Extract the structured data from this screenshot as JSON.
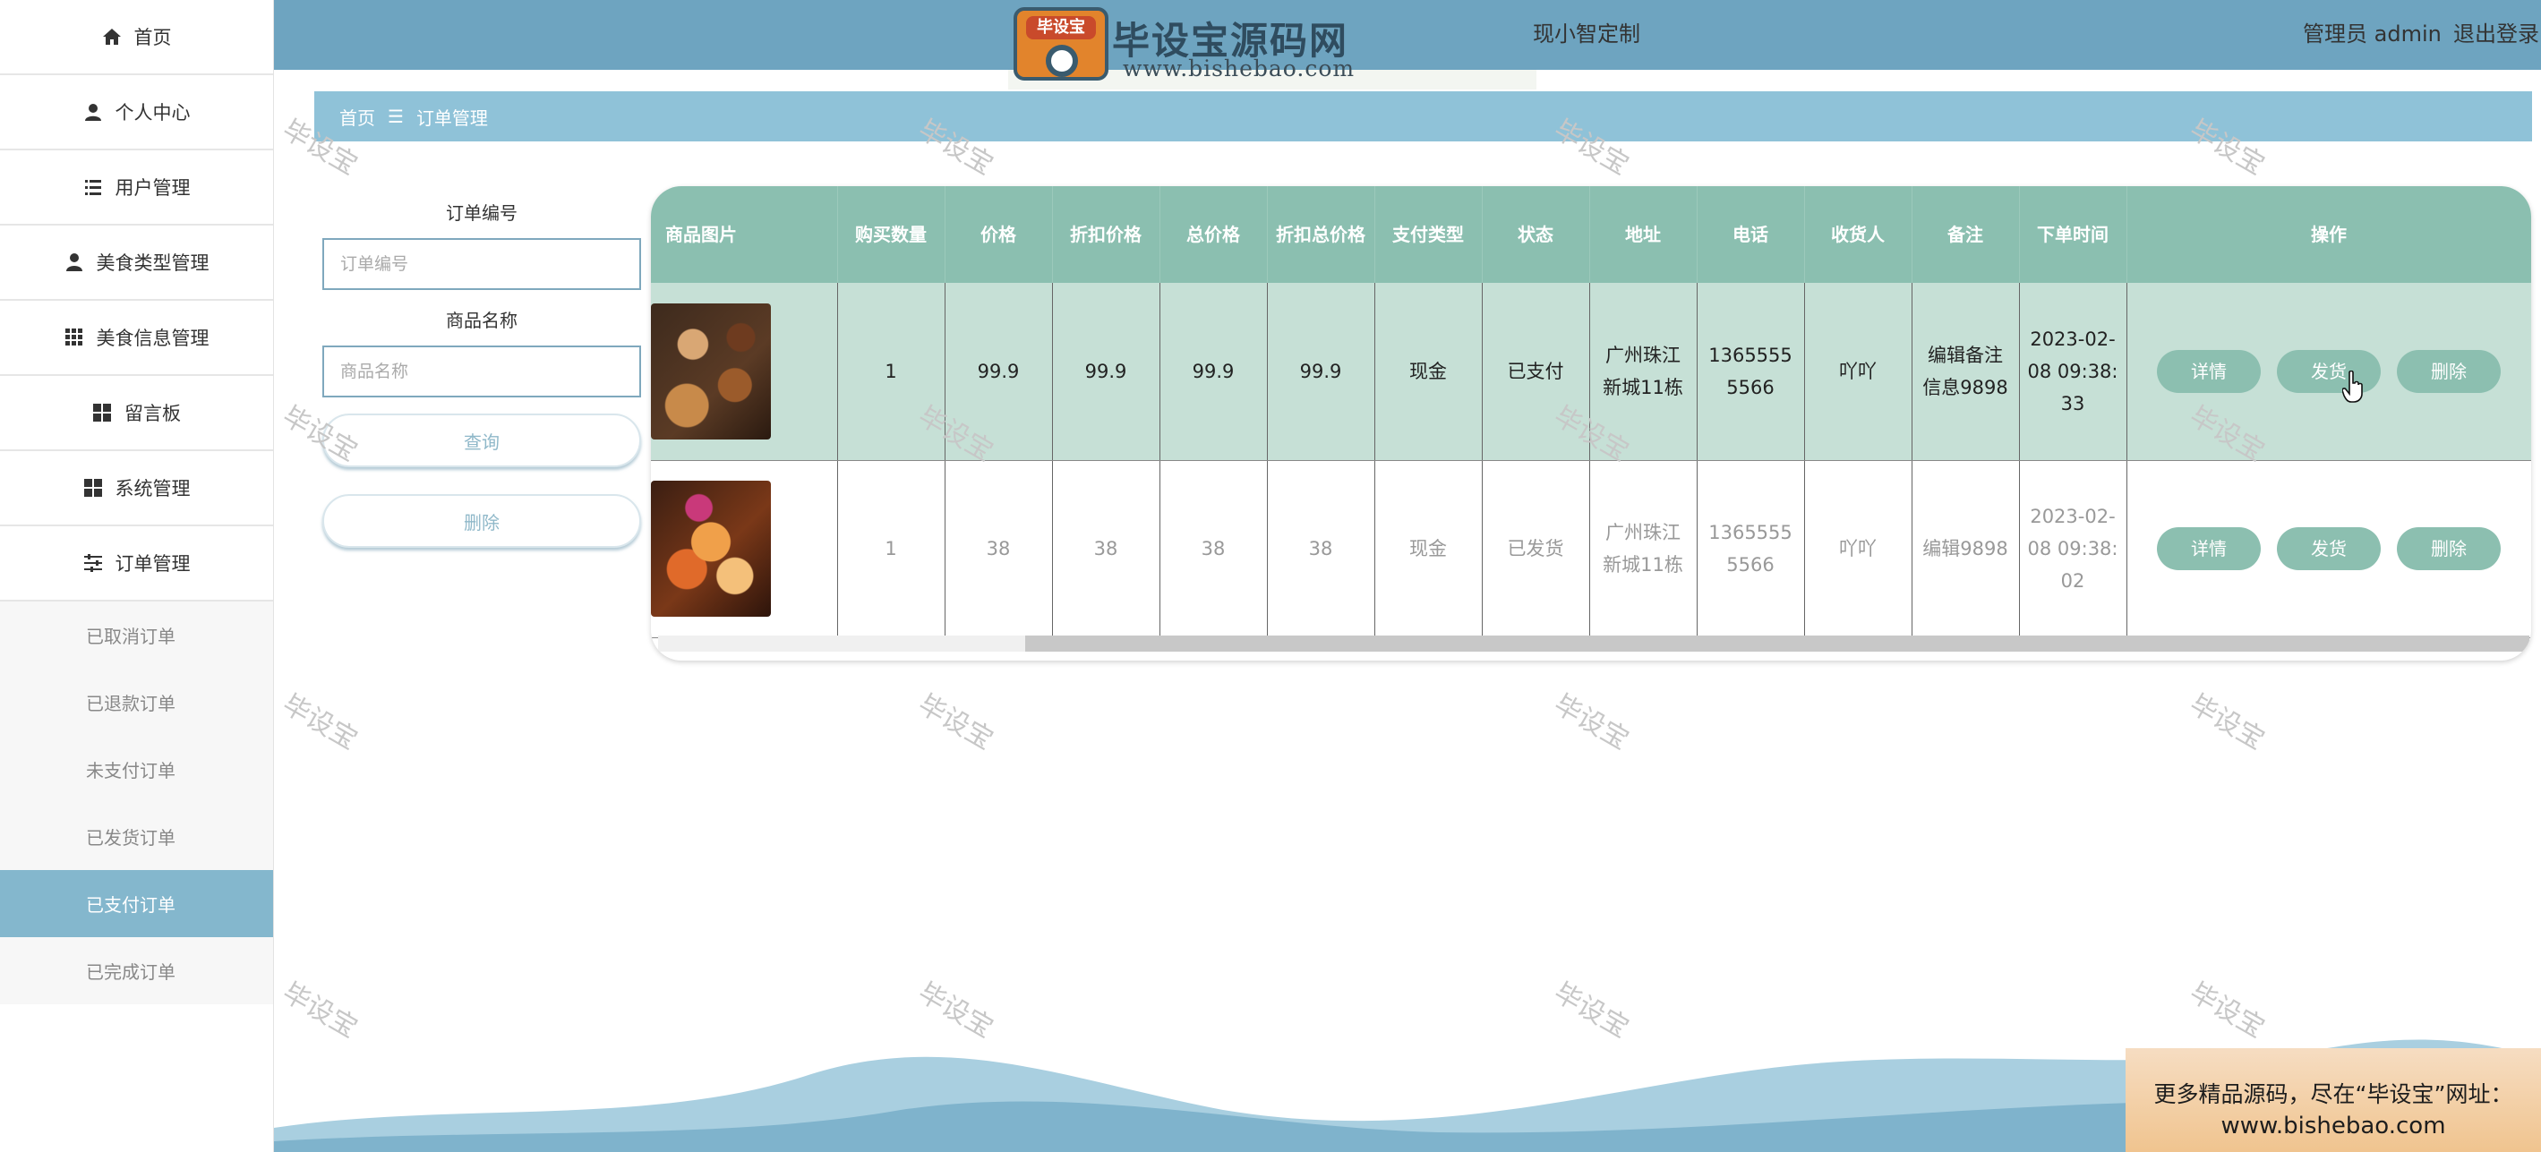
{
  "sidebar": {
    "items": [
      {
        "label": "首页",
        "icon": "home-icon"
      },
      {
        "label": "个人中心",
        "icon": "user-icon"
      },
      {
        "label": "用户管理",
        "icon": "list-icon"
      },
      {
        "label": "美食类型管理",
        "icon": "user-tie-icon"
      },
      {
        "label": "美食信息管理",
        "icon": "grid-icon"
      },
      {
        "label": "留言板",
        "icon": "apps-icon"
      },
      {
        "label": "系统管理",
        "icon": "apps-icon"
      },
      {
        "label": "订单管理",
        "icon": "sliders-icon"
      }
    ],
    "sub_items": [
      "已取消订单",
      "已退款订单",
      "未支付订单",
      "已发货订单",
      "已支付订单",
      "已完成订单"
    ],
    "active_sub": "已支付订单"
  },
  "header": {
    "logo_badge": "毕设宝",
    "logo_text": "毕设宝源码网",
    "logo_url": "www.bishebao.com",
    "title_partial": "现小智定制",
    "user": "管理员 admin",
    "logout": "退出登录"
  },
  "breadcrumb": {
    "home": "首页",
    "separator": "☰",
    "current": "订单管理"
  },
  "search": {
    "order_no_label": "订单编号",
    "order_no_placeholder": "订单编号",
    "product_name_label": "商品名称",
    "product_name_placeholder": "商品名称",
    "query_button": "查询",
    "delete_button": "删除"
  },
  "table": {
    "columns": [
      "商品图片",
      "购买数量",
      "价格",
      "折扣价格",
      "总价格",
      "折扣总价格",
      "支付类型",
      "状态",
      "地址",
      "电话",
      "收货人",
      "备注",
      "下单时间",
      "操作"
    ],
    "rows": [
      {
        "qty": "1",
        "price": "99.9",
        "discount_price": "99.9",
        "total": "99.9",
        "discount_total": "99.9",
        "pay_type": "现金",
        "status": "已支付",
        "address": "广州珠江新城11栋",
        "phone": "13655555566",
        "receiver": "吖吖",
        "note": "编辑备注信息9898",
        "time": "2023-02-08 09:38:33"
      },
      {
        "qty": "1",
        "price": "38",
        "discount_price": "38",
        "total": "38",
        "discount_total": "38",
        "pay_type": "现金",
        "status": "已发货",
        "address": "广州珠江新城11栋",
        "phone": "13655555566",
        "receiver": "吖吖",
        "note": "编辑9898",
        "time": "2023-02-08 09:38:02"
      }
    ],
    "actions": {
      "detail": "详情",
      "ship": "发货",
      "delete": "删除"
    }
  },
  "watermark": "毕设宝",
  "ad": {
    "line1": "更多精品源码，尽在“毕设宝”网址：",
    "line2": "www.bishebao.com"
  },
  "colors": {
    "header": "#6ea4c0",
    "breadcrumb": "#8fc2d8",
    "table_header": "#8bbfb0",
    "row_highlight": "#c6e0d6",
    "active_menu": "#84b7cd"
  }
}
